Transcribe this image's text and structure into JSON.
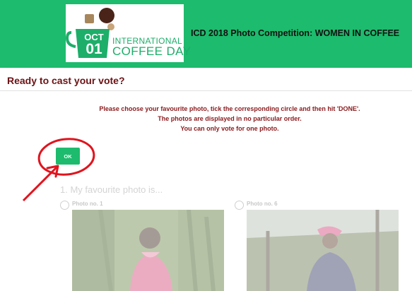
{
  "header": {
    "logo": {
      "month": "OCT",
      "day": "01",
      "line1": "INTERNATIONAL",
      "line2": "COFFEE DAY"
    },
    "title": "ICD 2018 Photo Competition: WOMEN IN COFFEE"
  },
  "survey": {
    "heading": "Ready to cast your vote?",
    "instructions": [
      "Please choose your favourite photo, tick the corresponding circle and then hit 'DONE'.",
      "The photos are displayed in no particular order.",
      "You can only vote for one photo."
    ],
    "ok_label": "OK",
    "question": "1. My favourite photo is...",
    "options": [
      {
        "label": "Photo no. 1"
      },
      {
        "label": "Photo no. 6"
      }
    ]
  },
  "colors": {
    "brand_green": "#1dbb6d",
    "heading_maroon": "#6b1214",
    "annotation_red": "#e0141e"
  }
}
